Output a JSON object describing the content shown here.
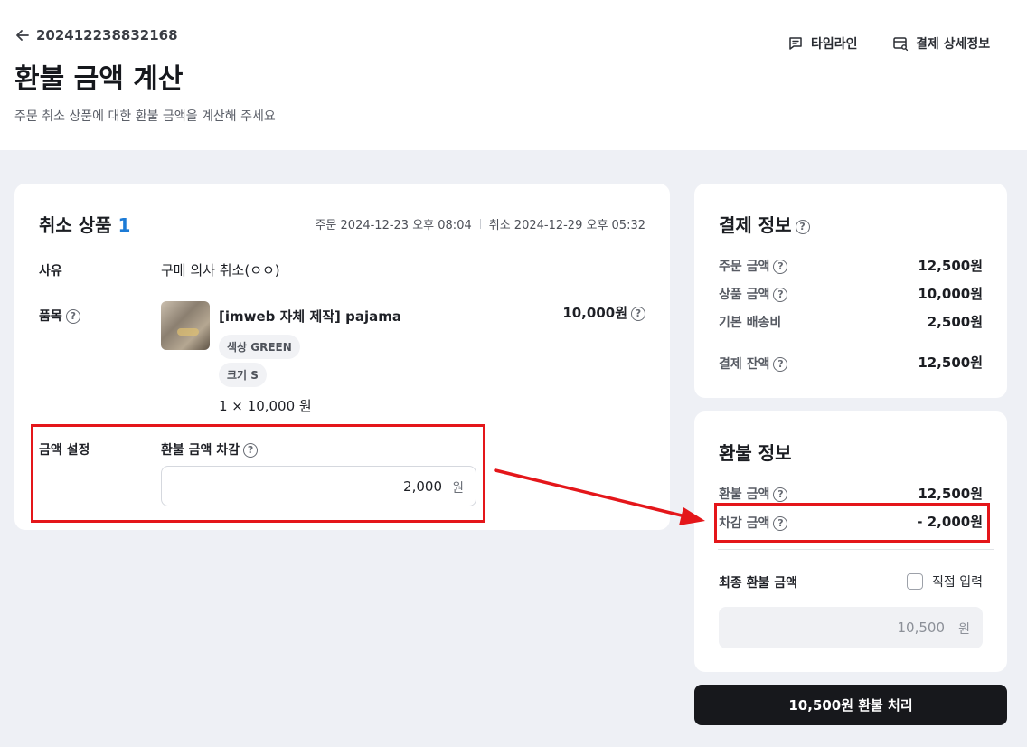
{
  "header": {
    "order_number": "202412238832168",
    "title": "환불 금액 계산",
    "subtitle": "주문 취소 상품에 대한 환불 금액을 계산해 주세요",
    "timeline_label": "타임라인",
    "payment_detail_label": "결제 상세정보"
  },
  "cancel_items": {
    "title": "취소 상품",
    "count": "1",
    "order_date_label": "주문",
    "order_date": "2024-12-23 오후 08:04",
    "cancel_date_label": "취소",
    "cancel_date": "2024-12-29 오후 05:32",
    "reason_label": "사유",
    "reason_value": "구매 의사 취소(ㅇㅇ)",
    "item_label": "품목",
    "product": {
      "name": "[imweb 자체 제작] pajama",
      "option_color": "색상 GREEN",
      "option_size": "크기 S",
      "qty_price": "1 × 10,000 원",
      "price": "10,000원"
    },
    "amount_setting_label": "금액 설정",
    "deduction_label": "환불 금액 차감",
    "deduction_value": "2,000",
    "unit": "원"
  },
  "payment_info": {
    "title": "결제 정보",
    "rows": [
      {
        "label": "주문 금액",
        "value": "12,500원"
      },
      {
        "label": "상품 금액",
        "value": "10,000원"
      },
      {
        "label": "기본 배송비",
        "value": "2,500원"
      },
      {
        "label": "결제 잔액",
        "value": "12,500원"
      }
    ]
  },
  "refund_info": {
    "title": "환불 정보",
    "refund_amount_label": "환불 금액",
    "refund_amount_value": "12,500원",
    "deduction_label": "차감 금액",
    "deduction_value": "- 2,000원",
    "final_label": "최종 환불 금액",
    "direct_input_label": "직접 입력",
    "final_value": "10,500",
    "unit": "원"
  },
  "submit_label": "10,500원 환불 처리",
  "colors": {
    "accent": "#1d7bd6",
    "annotation_red": "#e4161a",
    "button_dark": "#17181c"
  }
}
